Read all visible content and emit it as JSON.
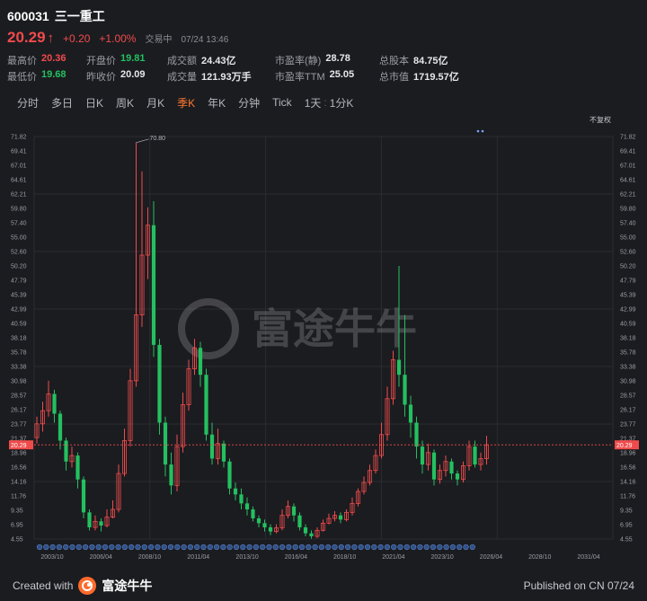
{
  "header": {
    "code": "600031",
    "name": "三一重工",
    "price": "20.29",
    "change": "+0.20",
    "change_pct": "+1.00%",
    "status": "交易中",
    "datetime": "07/24 13:46"
  },
  "stats": {
    "row1": [
      {
        "label": "最高价",
        "value": "20.36",
        "tone": "up"
      },
      {
        "label": "开盘价",
        "value": "19.81",
        "tone": "down"
      },
      {
        "label": "成交额",
        "value": "24.43亿",
        "tone": ""
      },
      {
        "label": "市盈率(静)",
        "value": "28.78",
        "tone": ""
      },
      {
        "label": "总股本",
        "value": "84.75亿",
        "tone": ""
      }
    ],
    "row2": [
      {
        "label": "最低价",
        "value": "19.68",
        "tone": "down"
      },
      {
        "label": "昨收价",
        "value": "20.09",
        "tone": ""
      },
      {
        "label": "成交量",
        "value": "121.93万手",
        "tone": ""
      },
      {
        "label": "市盈率TTM",
        "value": "25.05",
        "tone": ""
      },
      {
        "label": "总市值",
        "value": "1719.57亿",
        "tone": ""
      }
    ]
  },
  "tabs": [
    "分时",
    "多日",
    "日K",
    "周K",
    "月K",
    "季K",
    "年K",
    "分钟",
    "Tick",
    "1天",
    "1分K"
  ],
  "active_tab": "季K",
  "chart_labels": {
    "adjust": "不复权",
    "watermark": "富途牛牛",
    "max_label": "70.80",
    "min_label": "4.55",
    "current_price_tag": "20.29"
  },
  "colors": {
    "up": "#f04b4b",
    "down": "#24c060",
    "active_tab": "#ff7a2e",
    "background": "#1b1c20"
  },
  "footer": {
    "created_with": "Created with",
    "brand": "富途牛牛",
    "published": "Published on CN 07/24"
  },
  "chart_data": {
    "type": "candlestick",
    "period": "quarterly",
    "y_ticks": [
      71.82,
      69.41,
      67.01,
      64.61,
      62.21,
      59.8,
      57.4,
      55.0,
      52.6,
      50.2,
      47.79,
      45.39,
      42.99,
      40.59,
      38.18,
      35.78,
      33.38,
      30.98,
      28.57,
      26.17,
      23.77,
      21.37,
      18.96,
      16.56,
      14.16,
      11.76,
      9.35,
      6.95,
      4.55
    ],
    "ylim": [
      4.55,
      71.82
    ],
    "x_ticks": [
      "2003/10",
      "2006/04",
      "2008/10",
      "2011/04",
      "2013/10",
      "2016/04",
      "2018/10",
      "2021/04",
      "2023/10",
      "2026/04",
      "2028/10",
      "2031/04"
    ],
    "current_price": 20.29,
    "candles": [
      [
        21.5,
        23.8,
        25.0,
        20.5
      ],
      [
        23.8,
        26.0,
        27.5,
        22.5
      ],
      [
        26.0,
        28.8,
        31.0,
        25.0
      ],
      [
        28.8,
        25.5,
        29.5,
        24.0
      ],
      [
        25.5,
        21.0,
        26.0,
        19.5
      ],
      [
        21.0,
        17.5,
        21.5,
        16.0
      ],
      [
        17.5,
        18.5,
        20.0,
        16.5
      ],
      [
        18.5,
        14.5,
        19.0,
        13.0
      ],
      [
        14.5,
        9.0,
        15.0,
        8.0
      ],
      [
        9.0,
        6.5,
        9.5,
        6.0
      ],
      [
        6.5,
        7.5,
        8.5,
        6.0
      ],
      [
        7.5,
        6.8,
        8.0,
        5.8
      ],
      [
        6.8,
        8.2,
        9.5,
        6.5
      ],
      [
        8.2,
        9.5,
        11.0,
        8.0
      ],
      [
        9.5,
        15.5,
        17.0,
        9.0
      ],
      [
        15.5,
        21.0,
        23.0,
        15.0
      ],
      [
        21.0,
        31.0,
        33.0,
        20.0
      ],
      [
        31.0,
        42.0,
        70.8,
        30.0
      ],
      [
        42.0,
        52.0,
        66.0,
        40.0
      ],
      [
        52.0,
        57.0,
        60.0,
        48.0
      ],
      [
        57.0,
        37.0,
        61.0,
        35.0
      ],
      [
        37.0,
        24.0,
        38.0,
        22.0
      ],
      [
        24.0,
        17.0,
        25.0,
        15.0
      ],
      [
        17.0,
        13.5,
        19.0,
        12.0
      ],
      [
        13.5,
        20.0,
        22.0,
        12.5
      ],
      [
        20.0,
        27.0,
        29.0,
        19.0
      ],
      [
        27.0,
        33.0,
        34.5,
        26.0
      ],
      [
        33.0,
        36.5,
        38.0,
        32.0
      ],
      [
        36.5,
        32.0,
        37.5,
        30.0
      ],
      [
        32.0,
        22.0,
        33.0,
        21.0
      ],
      [
        22.0,
        18.0,
        24.0,
        17.0
      ],
      [
        18.0,
        20.5,
        23.0,
        17.0
      ],
      [
        20.5,
        17.5,
        21.0,
        16.5
      ],
      [
        17.5,
        13.0,
        18.0,
        12.0
      ],
      [
        13.0,
        12.0,
        14.0,
        11.0
      ],
      [
        12.0,
        10.5,
        13.0,
        9.5
      ],
      [
        10.5,
        9.5,
        11.5,
        8.5
      ],
      [
        9.5,
        8.0,
        10.0,
        7.5
      ],
      [
        8.0,
        7.2,
        8.5,
        6.5
      ],
      [
        7.2,
        6.5,
        7.8,
        5.8
      ],
      [
        6.5,
        5.8,
        7.0,
        5.2
      ],
      [
        5.8,
        6.4,
        7.0,
        5.5
      ],
      [
        6.4,
        8.5,
        9.5,
        6.0
      ],
      [
        8.5,
        10.0,
        11.0,
        8.0
      ],
      [
        10.0,
        8.5,
        10.5,
        7.5
      ],
      [
        8.5,
        6.5,
        9.0,
        6.0
      ],
      [
        6.5,
        5.5,
        7.0,
        5.0
      ],
      [
        5.5,
        5.0,
        6.0,
        4.6
      ],
      [
        5.0,
        6.0,
        6.5,
        4.7
      ],
      [
        6.0,
        7.2,
        7.8,
        5.8
      ],
      [
        7.2,
        8.0,
        8.8,
        7.0
      ],
      [
        8.0,
        8.5,
        9.2,
        7.5
      ],
      [
        8.5,
        7.8,
        9.0,
        7.2
      ],
      [
        7.8,
        9.0,
        9.5,
        7.5
      ],
      [
        9.0,
        10.5,
        11.5,
        8.5
      ],
      [
        10.5,
        12.5,
        13.0,
        10.0
      ],
      [
        12.5,
        14.0,
        15.0,
        12.0
      ],
      [
        14.0,
        16.0,
        17.0,
        13.5
      ],
      [
        16.0,
        18.5,
        19.5,
        15.5
      ],
      [
        18.5,
        22.0,
        24.0,
        18.0
      ],
      [
        22.0,
        28.0,
        30.0,
        21.0
      ],
      [
        28.0,
        34.5,
        36.0,
        27.0
      ],
      [
        34.5,
        32.0,
        50.2,
        30.0
      ],
      [
        32.0,
        27.0,
        42.0,
        25.0
      ],
      [
        27.0,
        24.0,
        28.5,
        21.5
      ],
      [
        24.0,
        20.0,
        25.0,
        18.0
      ],
      [
        20.0,
        17.0,
        21.0,
        15.5
      ],
      [
        17.0,
        19.0,
        20.5,
        16.0
      ],
      [
        19.0,
        14.5,
        19.5,
        13.5
      ],
      [
        14.5,
        16.0,
        17.0,
        13.8
      ],
      [
        16.0,
        17.5,
        18.5,
        15.0
      ],
      [
        17.5,
        15.5,
        18.0,
        14.5
      ],
      [
        15.5,
        14.5,
        16.0,
        13.5
      ],
      [
        14.5,
        16.8,
        17.5,
        14.0
      ],
      [
        16.8,
        20.0,
        21.0,
        16.0
      ],
      [
        20.0,
        17.0,
        21.0,
        16.5
      ],
      [
        17.0,
        18.0,
        19.0,
        16.0
      ],
      [
        18.0,
        20.29,
        21.8,
        17.0
      ]
    ]
  }
}
